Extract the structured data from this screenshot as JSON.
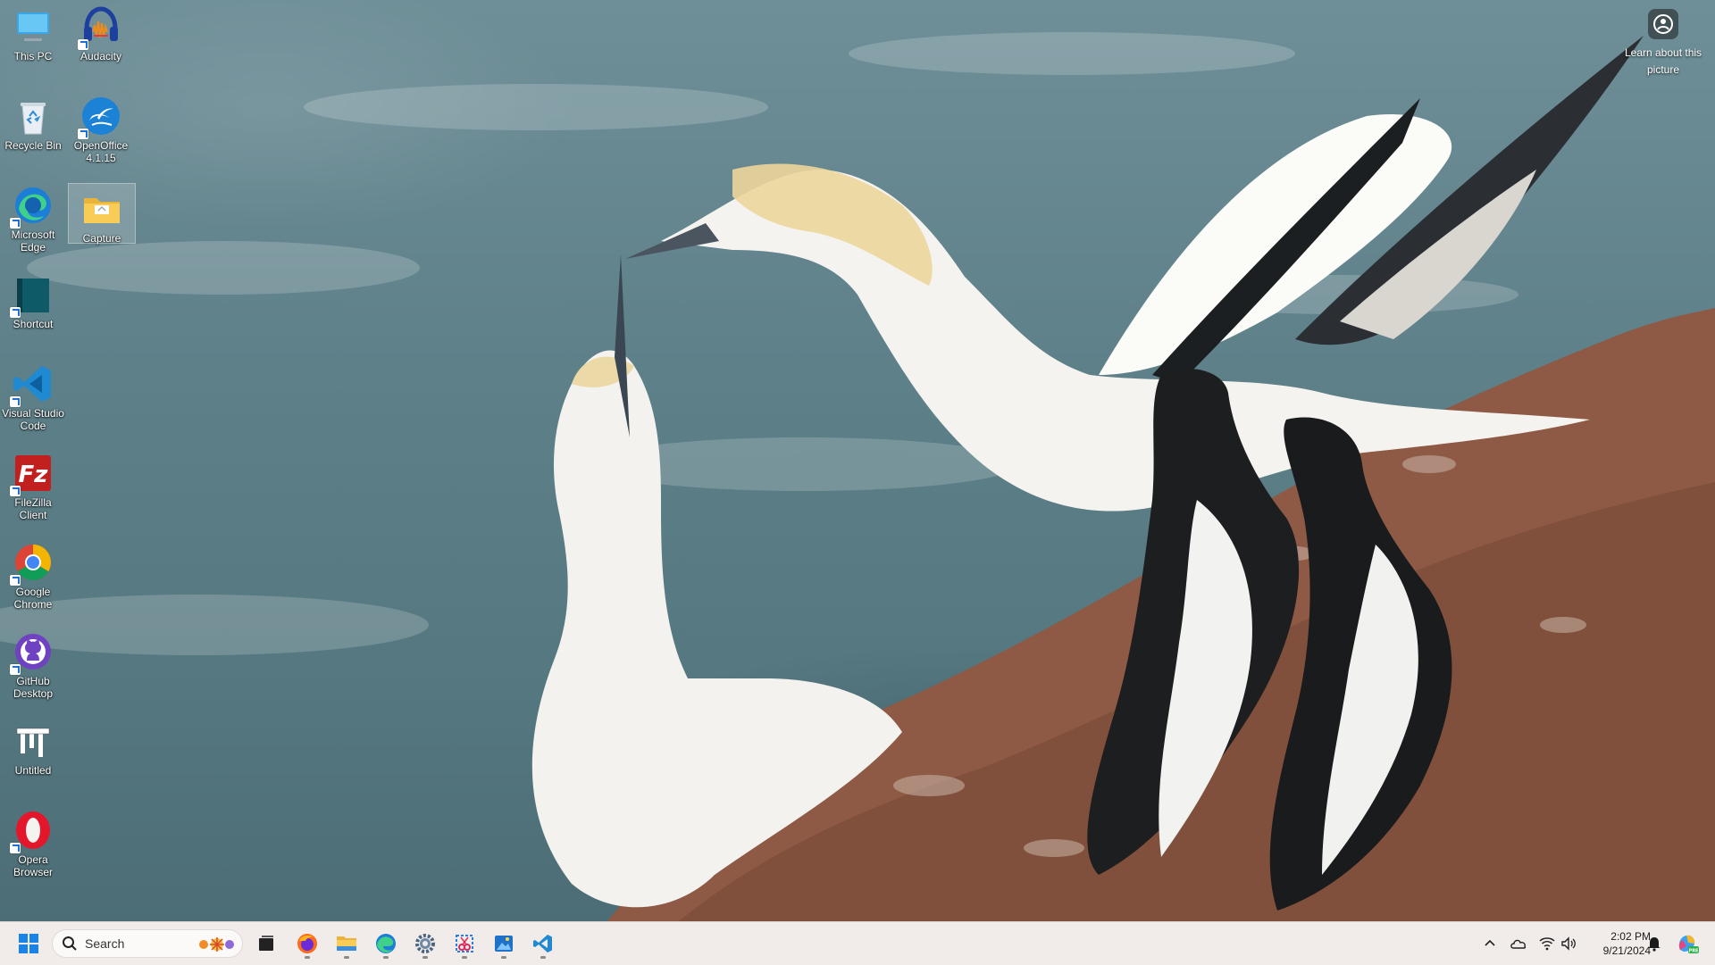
{
  "desktop": {
    "icons": [
      {
        "label": "This PC",
        "icon": "monitor-icon"
      },
      {
        "label": "Audacity",
        "icon": "audacity-icon"
      },
      {
        "label": "Recycle Bin",
        "icon": "recycle-bin-icon"
      },
      {
        "label": "OpenOffice 4.1.15",
        "icon": "openoffice-icon"
      },
      {
        "label": "Microsoft Edge",
        "icon": "edge-icon"
      },
      {
        "label": "Capture",
        "icon": "folder-icon"
      },
      {
        "label": "Shortcut",
        "icon": "shortcut-icon"
      },
      {
        "label": "Visual Studio Code",
        "icon": "vscode-icon"
      },
      {
        "label": "FileZilla Client",
        "icon": "filezilla-icon"
      },
      {
        "label": "Google Chrome",
        "icon": "chrome-icon"
      },
      {
        "label": "GitHub Desktop",
        "icon": "github-icon"
      },
      {
        "label": "Untitled",
        "icon": "untitled-icon"
      },
      {
        "label": "Opera Browser",
        "icon": "opera-icon"
      }
    ],
    "learn_about_picture": "Learn about this picture"
  },
  "taskbar": {
    "search_placeholder": "Search",
    "pinned": [
      "start-icon",
      "task-view-icon",
      "firefox-icon",
      "file-explorer-icon",
      "edge-icon",
      "settings-icon",
      "snipping-tool-icon",
      "photos-icon",
      "vscode-icon"
    ],
    "clock_time": "2:02 PM",
    "clock_date": "9/21/2024",
    "tray": [
      "chevron-up-icon",
      "onedrive-icon",
      "wifi-icon",
      "volume-icon",
      "bell-icon",
      "copilot-icon"
    ]
  },
  "colors": {
    "taskbar_bg": "#f1ece9",
    "accent": "#0078d4"
  }
}
